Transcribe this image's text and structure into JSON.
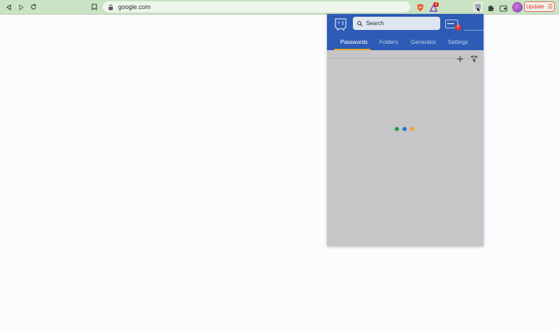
{
  "browser": {
    "url": "google.com",
    "rewards_badge": "1",
    "update_label": "Update",
    "menu_glyph": "☰"
  },
  "extension": {
    "search_placeholder": "Search",
    "notification_count": "0",
    "tabs": [
      {
        "label": "Passwords",
        "active": true
      },
      {
        "label": "Folders"
      },
      {
        "label": "Generator"
      },
      {
        "label": "Settings"
      }
    ],
    "loader_colors": [
      "#2e9a44",
      "#2f6fd6",
      "#f2a824"
    ]
  },
  "colors": {
    "toolbar": "#c9e3c4",
    "popup_header": "#2d5bb5",
    "tab_accent": "#f5a623",
    "popup_body": "#c6c5c8"
  }
}
